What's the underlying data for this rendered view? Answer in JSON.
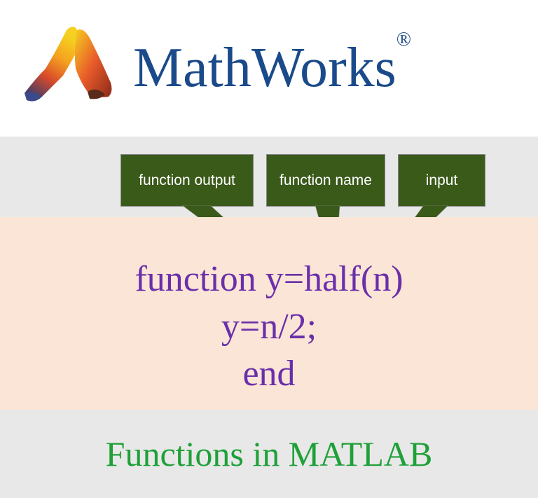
{
  "header": {
    "brand": "MathWorks",
    "registered": "®"
  },
  "callouts": {
    "output": "function output",
    "name": "function name",
    "input": "input"
  },
  "code": {
    "line1_a": "function ",
    "line1_b": "y",
    "line1_c": "=",
    "line1_d": "half",
    "line1_e": "(",
    "line1_f": "n",
    "line1_g": ")",
    "line2": "y=n/2;",
    "line3": "end"
  },
  "footer": {
    "title": "Functions in MATLAB"
  }
}
